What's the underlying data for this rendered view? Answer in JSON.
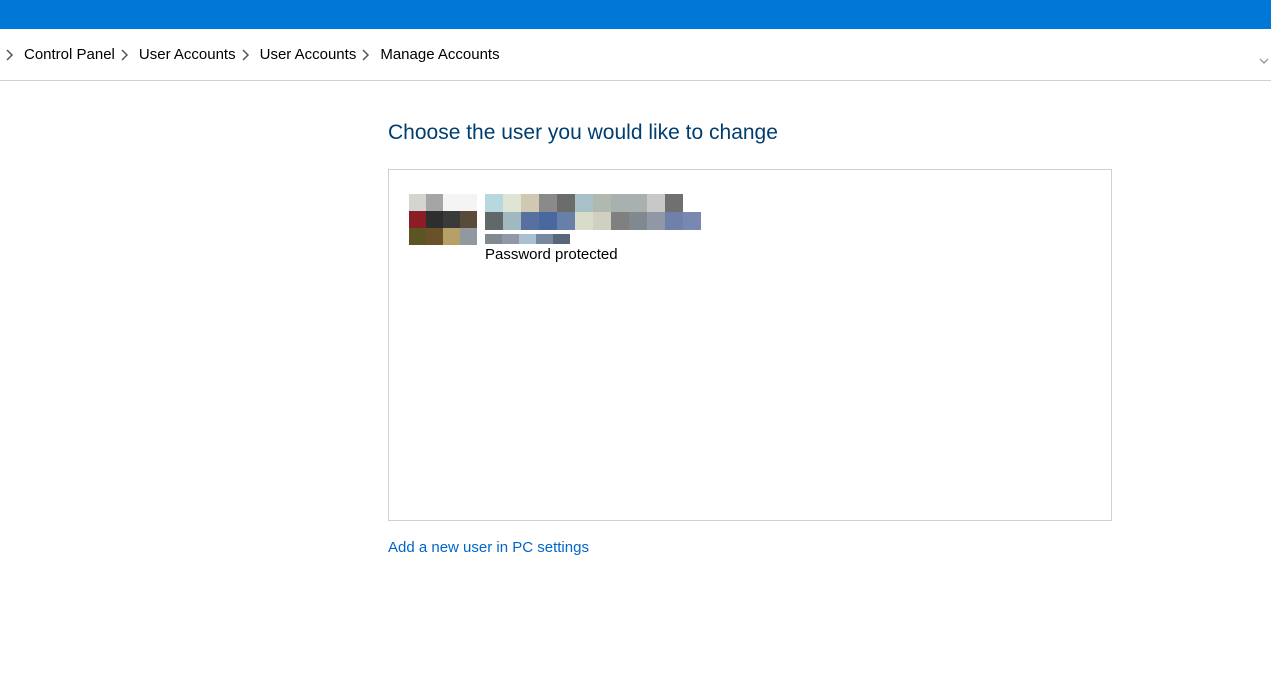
{
  "breadcrumb": {
    "items": [
      {
        "label": "Control Panel"
      },
      {
        "label": "User Accounts"
      },
      {
        "label": "User Accounts"
      }
    ],
    "current": "Manage Accounts"
  },
  "main": {
    "title": "Choose the user you would like to change",
    "user": {
      "status": "Password protected"
    },
    "add_user_label": "Add a new user in PC settings"
  }
}
